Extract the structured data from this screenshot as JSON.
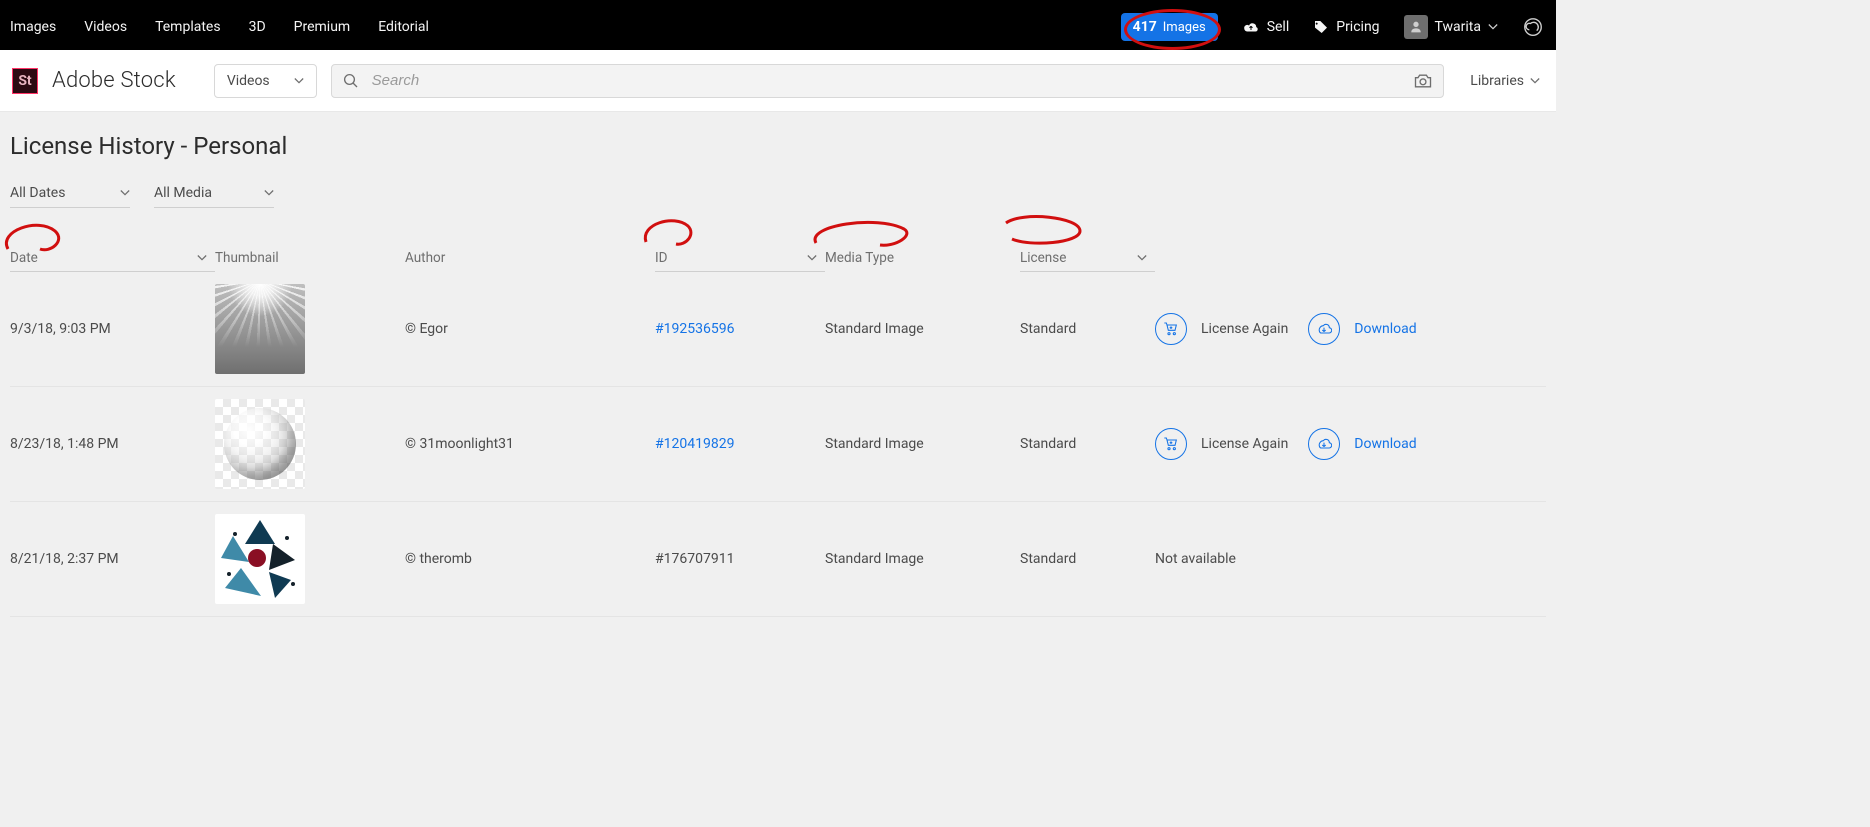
{
  "globalnav": {
    "links": [
      "Images",
      "Videos",
      "Templates",
      "3D",
      "Premium",
      "Editorial"
    ],
    "images_badge_count": "417",
    "images_badge_label": "Images",
    "sell": "Sell",
    "pricing": "Pricing",
    "user": "Twarita"
  },
  "brand": {
    "logo_text": "St",
    "name": "Adobe Stock"
  },
  "search": {
    "category_selected": "Videos",
    "placeholder": "Search",
    "libraries_label": "Libraries"
  },
  "page": {
    "title": "License History - Personal",
    "filters": {
      "date": "All Dates",
      "media": "All Media"
    }
  },
  "columns": {
    "date": "Date",
    "thumbnail": "Thumbnail",
    "author": "Author",
    "id": "ID",
    "media_type": "Media Type",
    "license": "License"
  },
  "labels": {
    "license_again": "License Again",
    "download": "Download",
    "not_available": "Not available"
  },
  "rows": [
    {
      "date": "9/3/18, 9:03 PM",
      "author": "© Egor",
      "id": "#192536596",
      "id_link": true,
      "media_type": "Standard Image",
      "license": "Standard",
      "thumb": "rays",
      "actions": "full"
    },
    {
      "date": "8/23/18, 1:48 PM",
      "author": "© 31moonlight31",
      "id": "#120419829",
      "id_link": true,
      "media_type": "Standard Image",
      "license": "Standard",
      "thumb": "sphere",
      "actions": "full"
    },
    {
      "date": "8/21/18, 2:37 PM",
      "author": "© theromb",
      "id": "#176707911",
      "id_link": false,
      "media_type": "Standard Image",
      "license": "Standard",
      "thumb": "tri",
      "actions": "na"
    }
  ]
}
